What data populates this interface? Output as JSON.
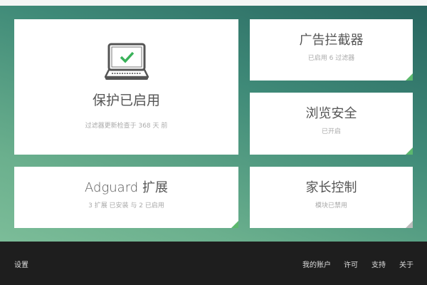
{
  "protection": {
    "title": "保护已启用",
    "subtitle": "过滤器更新检查于 368 天 前"
  },
  "ad_blocker": {
    "title": "广告拦截器",
    "subtitle": "已启用 6 过滤器",
    "status_color": "#5cb86e"
  },
  "browsing_security": {
    "title": "浏览安全",
    "subtitle": "已开启",
    "status_color": "#5cb86e"
  },
  "extensions": {
    "title": "Adguard 扩展",
    "subtitle": "3 扩展 已安装 与 2 已启用",
    "status_color": "#5cb86e"
  },
  "parental_control": {
    "title": "家长控制",
    "subtitle": "模块已禁用",
    "status_color": "#bbbbbb"
  },
  "footer": {
    "settings": "设置",
    "account": "我的账户",
    "license": "许可",
    "support": "支持",
    "about": "关于"
  }
}
